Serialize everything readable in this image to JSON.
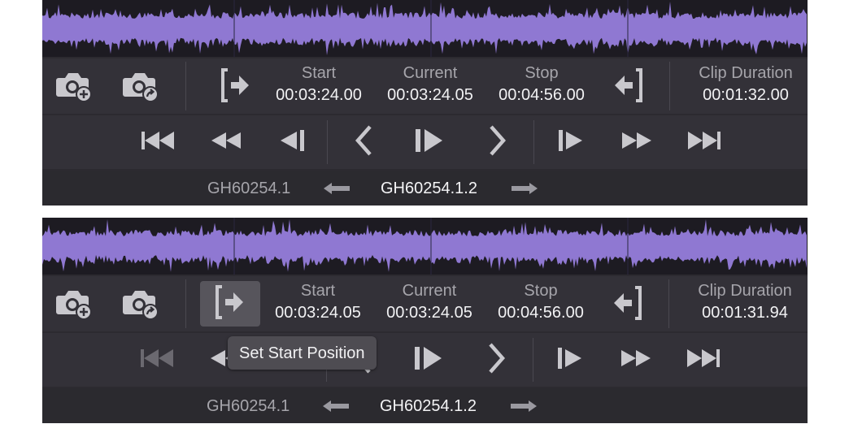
{
  "colors": {
    "waveform": "#8f78d2",
    "panel": "#333138",
    "text": "#f2f2f4",
    "label": "#a6a5ab"
  },
  "panels": [
    {
      "timecodes": {
        "start_label": "Start",
        "start_value": "00:03:24.00",
        "current_label": "Current",
        "current_value": "00:03:24.05",
        "stop_label": "Stop",
        "stop_value": "00:04:56.00",
        "duration_label": "Clip Duration",
        "duration_value": "00:01:32.00"
      },
      "clips": {
        "previous": "GH60254.1",
        "current": "GH60254.1.2"
      }
    },
    {
      "timecodes": {
        "start_label": "Start",
        "start_value": "00:03:24.05",
        "current_label": "Current",
        "current_value": "00:03:24.05",
        "stop_label": "Stop",
        "stop_value": "00:04:56.00",
        "duration_label": "Clip Duration",
        "duration_value": "00:01:31.94"
      },
      "clips": {
        "previous": "GH60254.1",
        "current": "GH60254.1.2"
      },
      "tooltip": "Set Start Position"
    }
  ],
  "icons": [
    "camera-add-icon",
    "camera-share-icon",
    "set-start-icon",
    "set-stop-icon",
    "skip-to-start-icon",
    "rewind-icon",
    "step-back-icon",
    "prev-icon",
    "play-icon",
    "next-icon",
    "step-forward-icon",
    "fast-forward-icon",
    "skip-to-end-icon",
    "arrow-left-icon",
    "arrow-right-icon"
  ]
}
